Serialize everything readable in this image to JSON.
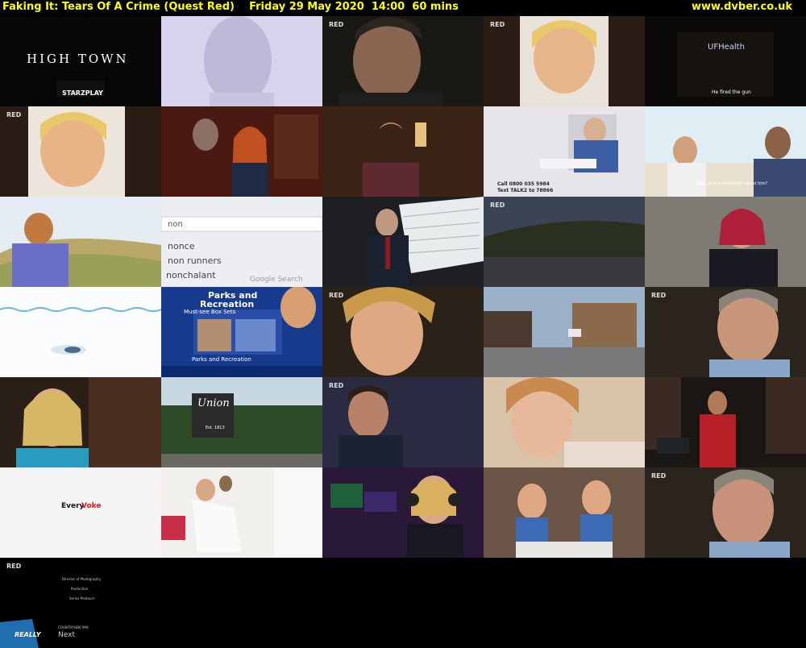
{
  "header": {
    "title": "Faking It: Tears Of A Crime (Quest Red)    Friday 29 May 2020  14:00  60 mins",
    "site": "www.dvber.co.uk"
  },
  "tiles": {
    "t1": {
      "line1": "HIGH TOWN",
      "line2": "STARZPLAY"
    },
    "t5": {
      "logo": "UFHealth",
      "caption": "He fired the gun"
    },
    "t8": {
      "line1": "Call 0800 035 5984",
      "line2": "Text TALK2 to 78866"
    },
    "t10": {
      "caption": "What do you remember about him?"
    },
    "t12": {
      "query": "non",
      "s1": "nonce",
      "s2": "non runners",
      "s3": "nonchalant",
      "brand": "Google Search"
    },
    "t17": {
      "line1": "Parks and",
      "line2": "Recreation",
      "line3": "Must-see Box Sets",
      "line4": "Parks and Recreation"
    },
    "t22": {
      "line1": "Union",
      "line2": "Est. 1813"
    },
    "t26": {
      "text1": "Every ",
      "text2": "Voke"
    },
    "t31": {
      "credit1": "Director of Photography",
      "credit2": "Production",
      "credit3": "Series Producer"
    },
    "t31b": {
      "brand": "REALLY",
      "label": "COUNTRYSIDE 999",
      "next": "Next"
    },
    "red_badge": "RED"
  },
  "colors": {
    "header_text": "#ffff00",
    "background": "#000000",
    "badge_red": "#e0202a"
  }
}
